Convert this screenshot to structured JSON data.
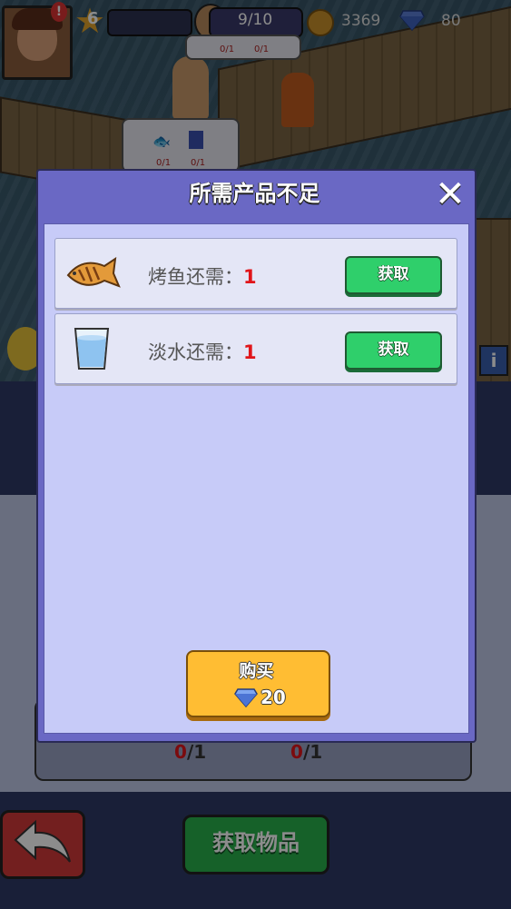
{
  "hud": {
    "level": "6",
    "population": "9/10",
    "coins": "3369",
    "gems": "80",
    "bubble_top_counts": [
      "0/1",
      "0/1"
    ],
    "bubble_mid_counts": [
      "0/1",
      "0/1"
    ]
  },
  "background": {
    "slot_counts": [
      {
        "have": "0",
        "need": "/1"
      },
      {
        "have": "0",
        "need": "/1"
      }
    ],
    "get_items_label": "获取物品"
  },
  "dialog": {
    "title": "所需产品不足",
    "items": [
      {
        "label": "烤鱼还需：",
        "qty": "1",
        "button": "获取",
        "icon": "grilled-fish-icon"
      },
      {
        "label": "淡水还需：",
        "qty": "1",
        "button": "获取",
        "icon": "water-glass-icon"
      }
    ],
    "buy": {
      "label": "购买",
      "price": "20"
    }
  },
  "colors": {
    "dialog_header": "#6a68c4",
    "dialog_body": "#c7cbf8",
    "get_button": "#2fcf6b",
    "buy_button": "#ffbd33",
    "qty_red": "#e0151a"
  }
}
